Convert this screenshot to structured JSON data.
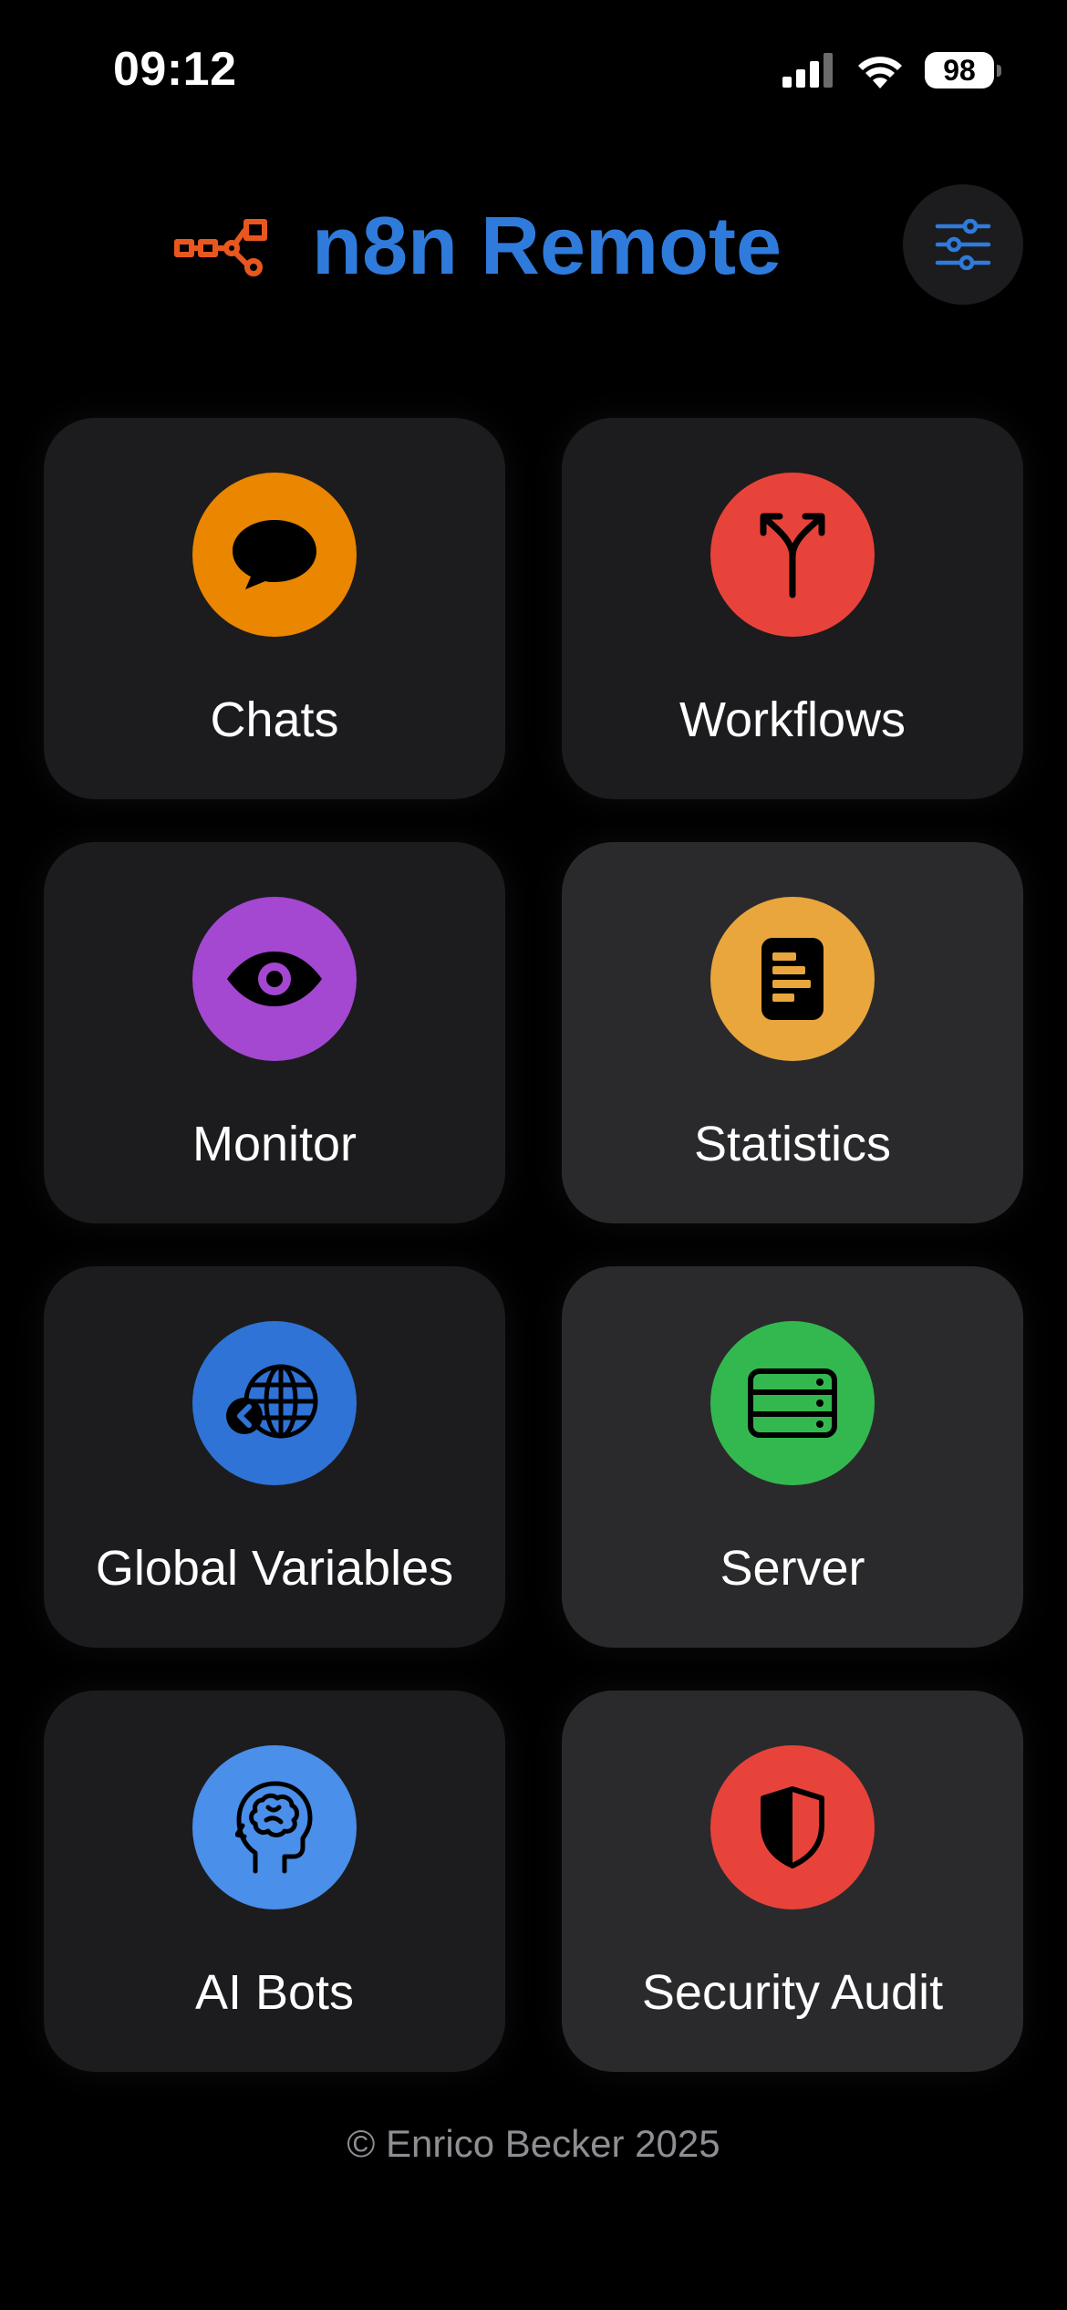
{
  "status_bar": {
    "time": "09:12",
    "battery": "98",
    "icons": [
      "cellular-signal-icon",
      "wifi-icon",
      "battery-icon"
    ]
  },
  "header": {
    "title": "n8n Remote",
    "logo_icon": "n8n-logo-icon",
    "settings_icon": "sliders-icon",
    "colors": {
      "title": "#2f7bdc",
      "logo": "#e8571f"
    }
  },
  "tiles": [
    {
      "label": "Chats",
      "icon": "chat-bubble-icon",
      "color": "#ea8600"
    },
    {
      "label": "Workflows",
      "icon": "split-arrow-icon",
      "color": "#e8433a"
    },
    {
      "label": "Monitor",
      "icon": "eye-icon",
      "color": "#a447d1"
    },
    {
      "label": "Statistics",
      "icon": "chart-document-icon",
      "color": "#e9a63c"
    },
    {
      "label": "Global Variables",
      "icon": "globe-icon",
      "color": "#2f73d6"
    },
    {
      "label": "Server",
      "icon": "server-rack-icon",
      "color": "#33b84f"
    },
    {
      "label": "AI Bots",
      "icon": "brain-head-icon",
      "color": "#4a8fea"
    },
    {
      "label": "Security Audit",
      "icon": "shield-icon",
      "color": "#e8433a"
    }
  ],
  "footer": {
    "text": "© Enrico Becker 2025"
  }
}
